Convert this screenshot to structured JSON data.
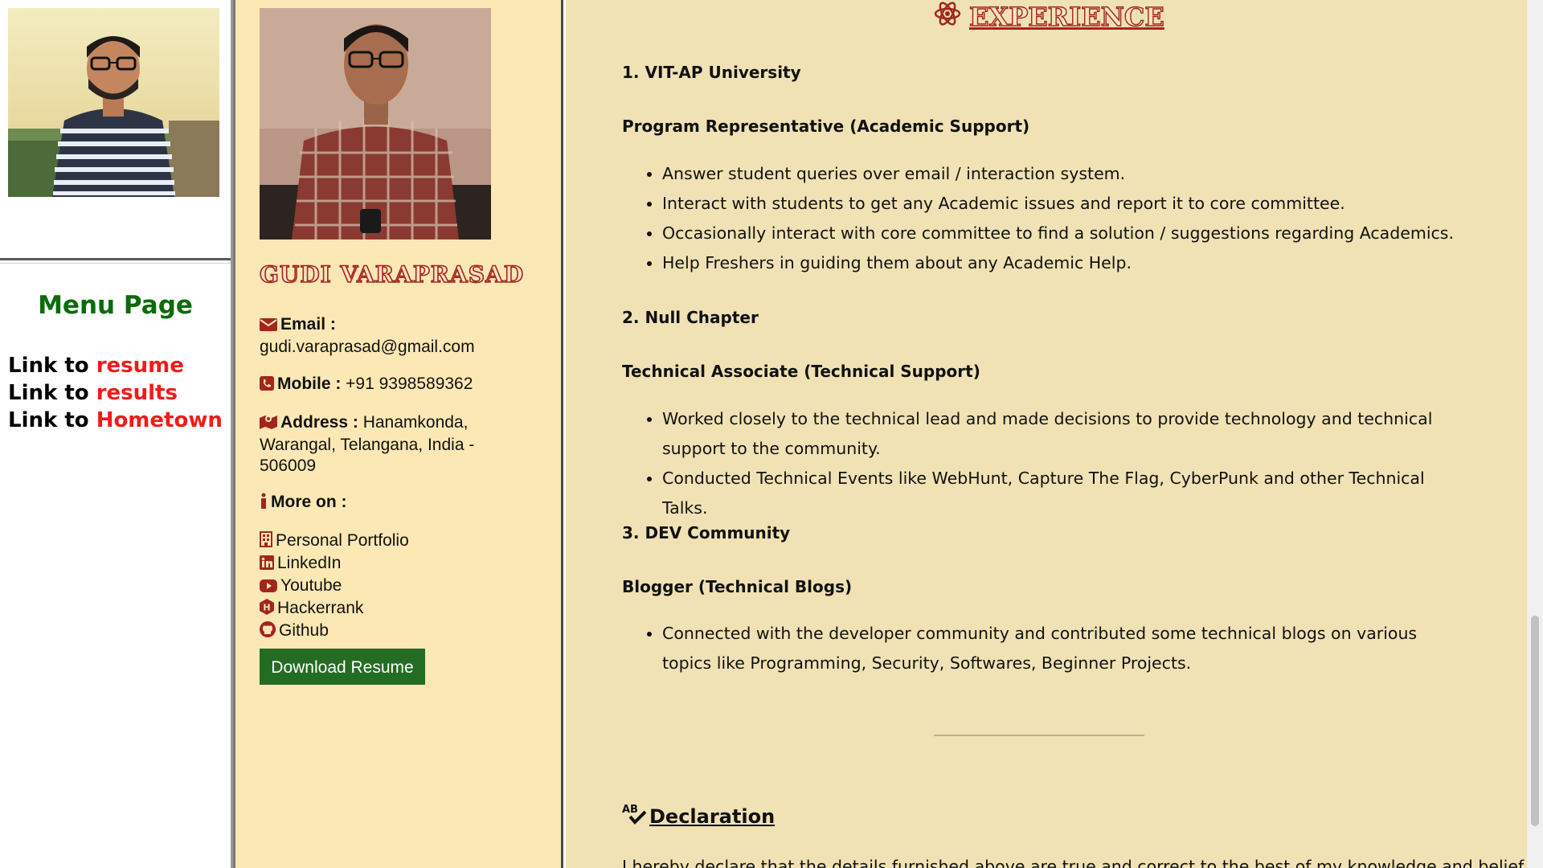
{
  "menu": {
    "title": "Menu Page",
    "links": [
      {
        "prefix": "Link to ",
        "label": "resume"
      },
      {
        "prefix": "Link to ",
        "label": "results"
      },
      {
        "prefix": "Link to ",
        "label": "Hometown"
      }
    ]
  },
  "profile": {
    "name": "GUDI VARAPRASAD",
    "email_label": "Email :",
    "email": "gudi.varaprasad@gmail.com",
    "mobile_label": "Mobile :",
    "mobile": "+91 9398589362",
    "address_label": "Address :",
    "address": "Hanamkonda, Warangal, Telangana, India - 506009",
    "more_label": "More on :",
    "links": [
      "Personal Portfolio",
      "LinkedIn",
      "Youtube",
      "Hackerrank",
      "Github"
    ],
    "download_label": "Download Resume"
  },
  "experience": {
    "heading": "EXPERIENCE",
    "entries": [
      {
        "org": "1. VIT-AP University",
        "role": "Program Representative (Academic Support)",
        "points": [
          "Answer student queries over email / interaction system.",
          "Interact with students to get any Academic issues and report it to core committee.",
          "Occasionally interact with core committee to find a solution / suggestions regarding Academics.",
          "Help Freshers in guiding them about any Academic Help."
        ]
      },
      {
        "org": "2. Null Chapter",
        "role": "Technical Associate (Technical Support)",
        "points": [
          "Worked closely to the technical lead and made decisions to provide technology and technical support to the community.",
          "Conducted Technical Events like WebHunt, Capture The Flag, CyberPunk and other Technical Talks."
        ]
      },
      {
        "org": "3. DEV Community",
        "role": "Blogger (Technical Blogs)",
        "points": [
          "Connected with the developer community and contributed some technical blogs on various topics like Programming, Security, Softwares, Beginner Projects."
        ]
      }
    ]
  },
  "declaration": {
    "heading": "Declaration",
    "text": "I hereby declare that the details furnished above are true and correct to the best of my knowledge and belief."
  },
  "colors": {
    "menu_title": "#0a6b0a",
    "link_highlight": "#f21a1a",
    "accent_red": "#a3261e",
    "button_green": "#246c24",
    "mid_bg": "#fce8b4",
    "main_bg": "#f0e2b4"
  }
}
